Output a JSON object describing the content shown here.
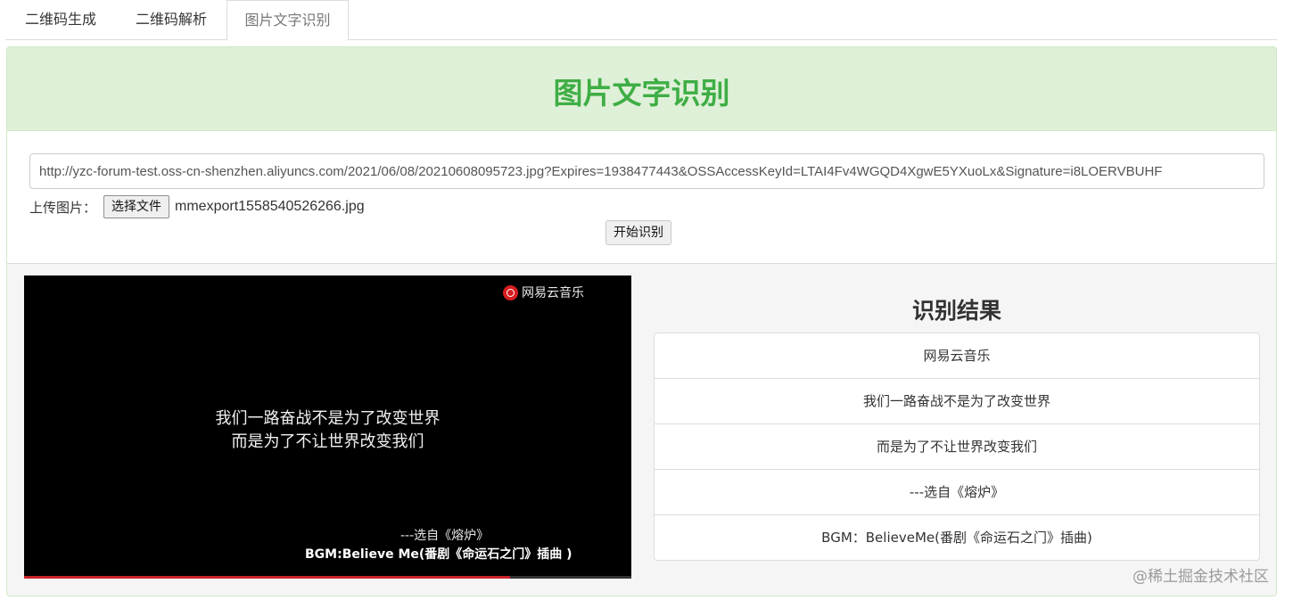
{
  "tabs": [
    {
      "label": "二维码生成"
    },
    {
      "label": "二维码解析"
    },
    {
      "label": "图片文字识别",
      "active": true
    }
  ],
  "panel": {
    "title": "图片文字识别",
    "url_value": "http://yzc-forum-test.oss-cn-shenzhen.aliyuncs.com/2021/06/08/20210608095723.jpg?Expires=1938477443&OSSAccessKeyId=LTAI4Fv4WGQD4XgwE5YXuoLx&Signature=i8LOERVBUHF",
    "upload_label": "上传图片：",
    "choose_file_label": "选择文件",
    "file_name": "mmexport1558540526266.jpg",
    "start_button": "开始识别"
  },
  "image": {
    "brand": "网易云音乐",
    "line1": "我们一路奋战不是为了改变世界",
    "line2": "而是为了不让世界改变我们",
    "source": "---选自《熔炉》",
    "bgm": "BGM:Believe Me(番剧《命运石之门》插曲 )",
    "progress": 0.8
  },
  "result": {
    "title": "识别结果",
    "items": [
      "网易云音乐",
      "我们一路奋战不是为了改变世界",
      "而是为了不让世界改变我们",
      "---选自《熔炉》",
      "BGM：BelieveMe(番剧《命运石之门》插曲)"
    ]
  },
  "watermark": "@稀土掘金技术社区",
  "colors": {
    "title_green": "#3eae45",
    "header_bg": "#dff0d8",
    "brand_red": "#d81e20"
  }
}
